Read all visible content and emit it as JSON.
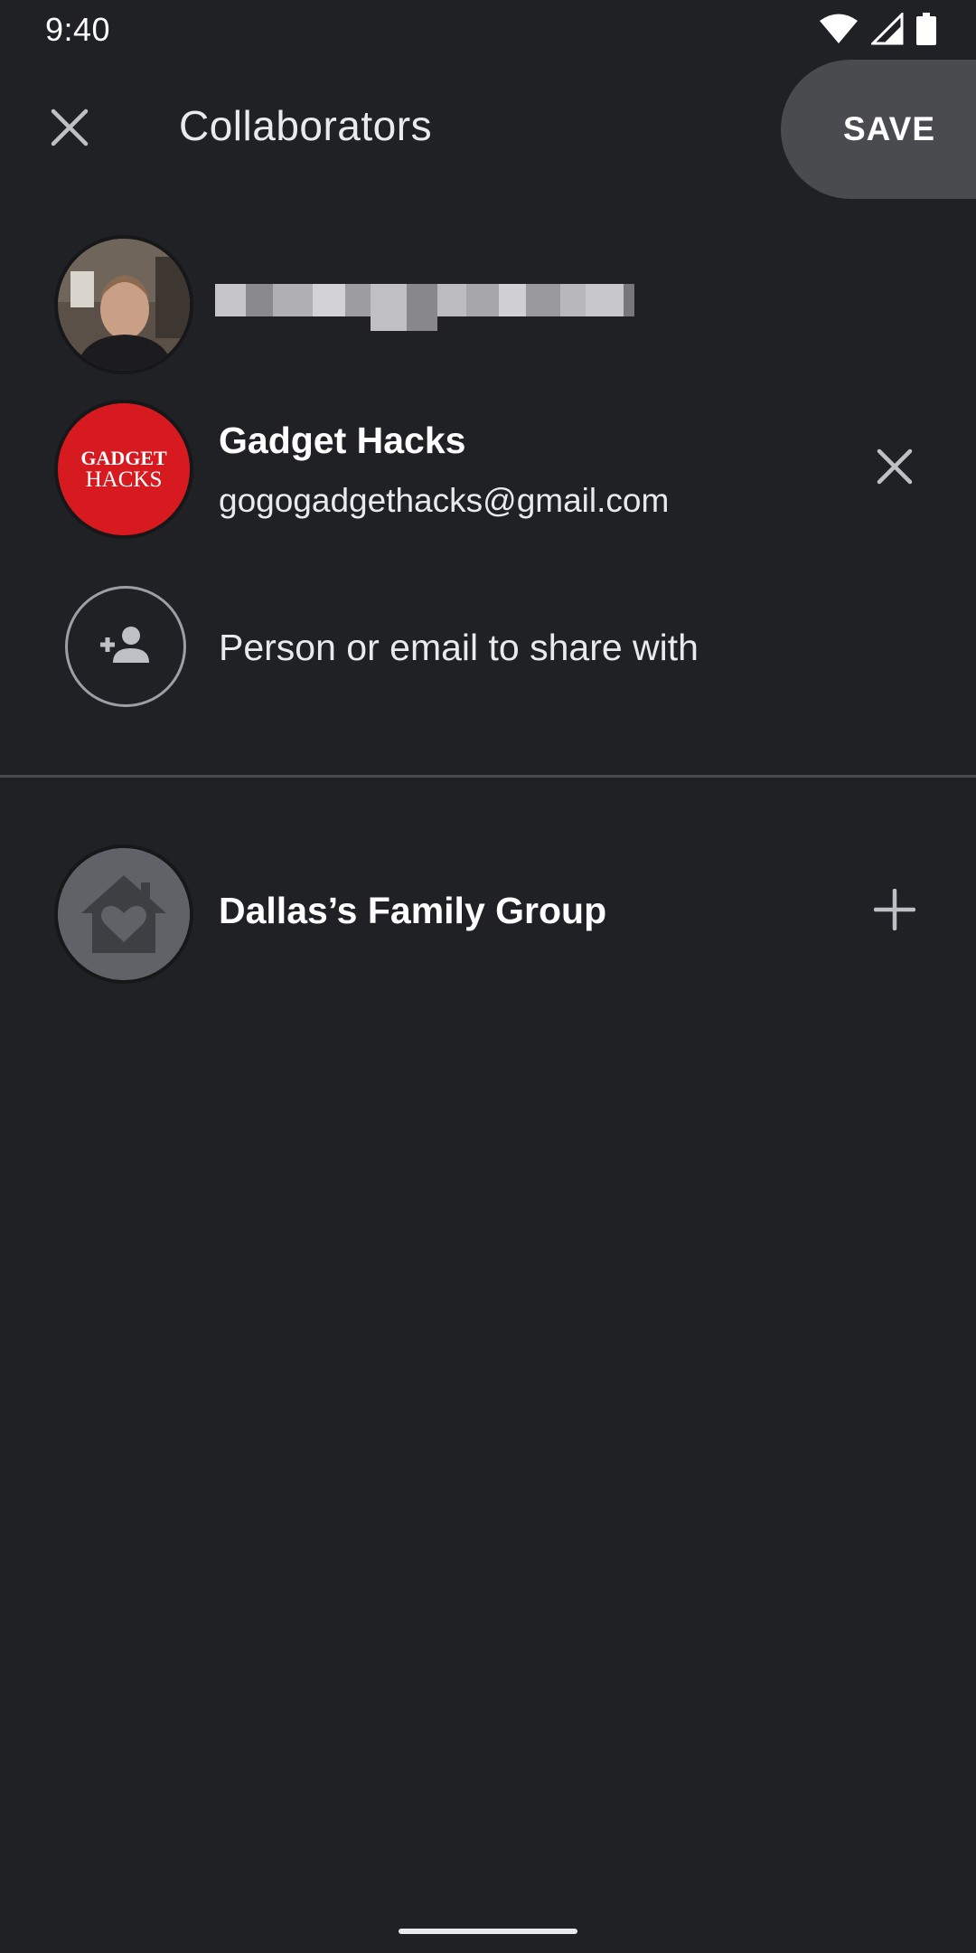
{
  "status_bar": {
    "time": "9:40",
    "icons": [
      "wifi-icon",
      "cell-signal-icon",
      "battery-icon"
    ]
  },
  "app_bar": {
    "close_icon": "close-icon",
    "title": "Collaborators",
    "save_label": "SAVE"
  },
  "collaborators": [
    {
      "name": "",
      "email": "",
      "avatar": "user-photo-avatar",
      "redacted": true
    },
    {
      "name": "Gadget Hacks",
      "email": "gogogadgethacks@gmail.com",
      "avatar_text_top": "GADGET",
      "avatar_text_bottom": "HACKS",
      "avatar_color": "#d71920",
      "action_icon": "close-icon"
    }
  ],
  "add_person": {
    "placeholder": "Person or email to share with",
    "icon": "add-person-icon"
  },
  "family_group": {
    "name": "Dallas’s Family Group",
    "icon": "house-heart-icon",
    "action_icon": "plus-icon"
  },
  "colors": {
    "background": "#202124",
    "text": "#e8eaed",
    "save_button_bg": "#4a4b4f",
    "divider": "#4a4b4f"
  }
}
